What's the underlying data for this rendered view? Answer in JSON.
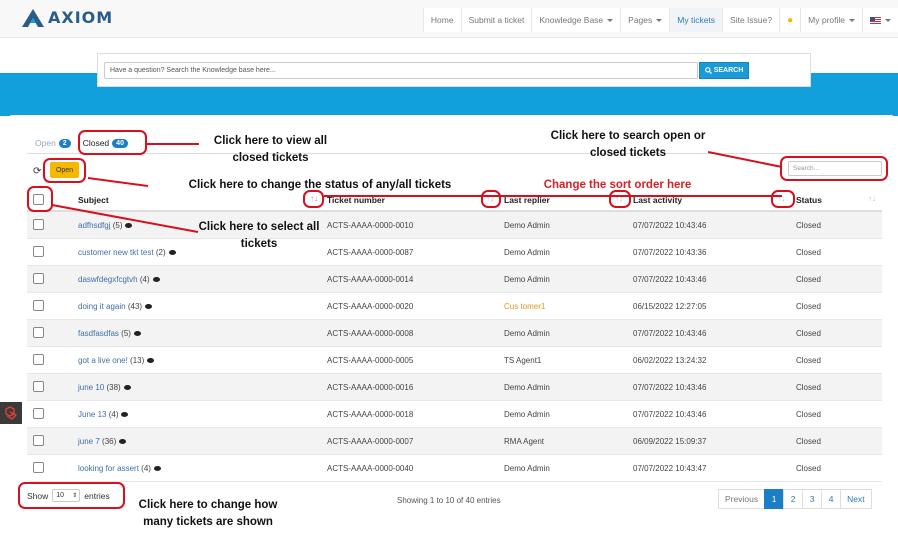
{
  "header": {
    "logo_text": "AXIOM",
    "nav": [
      {
        "label": "Home",
        "caret": false,
        "active": false
      },
      {
        "label": "Submit a ticket",
        "caret": false,
        "active": false
      },
      {
        "label": "Knowledge Base",
        "caret": true,
        "active": false
      },
      {
        "label": "Pages",
        "caret": true,
        "active": false
      },
      {
        "label": "My tickets",
        "caret": false,
        "active": true
      },
      {
        "label": "Site Issue?",
        "caret": false,
        "active": false
      },
      {
        "label": "",
        "icon": "lightbulb-icon",
        "caret": false,
        "active": false
      },
      {
        "label": "My profile",
        "caret": true,
        "active": false
      },
      {
        "label": "",
        "icon": "flag-us-icon",
        "caret": true,
        "active": false
      }
    ]
  },
  "search": {
    "placeholder": "Have a question? Search the Knowledge base here...",
    "button_label": "SEARCH"
  },
  "tabs": [
    {
      "label": "Open",
      "count": "2",
      "active": false
    },
    {
      "label": "Closed",
      "count": "40",
      "active": true
    }
  ],
  "toolbar": {
    "open_button": "Open",
    "table_search_placeholder": "Search..."
  },
  "table": {
    "headers": [
      "Subject",
      "Ticket number",
      "Last replier",
      "Last activity",
      "Status"
    ],
    "rows": [
      {
        "subject": "adfhsdfgj",
        "count": "(5)",
        "ticket": "ACTS-AAAA-0000-0010",
        "replier": "Demo Admin",
        "replier_color": "normal",
        "activity": "07/07/2022 10:43:46",
        "status": "Closed"
      },
      {
        "subject": "customer new tkt test",
        "count": "(2)",
        "ticket": "ACTS-AAAA-0000-0087",
        "replier": "Demo Admin",
        "replier_color": "normal",
        "activity": "07/07/2022 10:43:36",
        "status": "Closed"
      },
      {
        "subject": "daswfdegxfcgtvh",
        "count": "(4)",
        "ticket": "ACTS-AAAA-0000-0014",
        "replier": "Demo Admin",
        "replier_color": "normal",
        "activity": "07/07/2022 10:43:46",
        "status": "Closed"
      },
      {
        "subject": "doing it again",
        "count": "(43)",
        "ticket": "ACTS-AAAA-0000-0020",
        "replier": "Cus tomer1",
        "replier_color": "orange",
        "activity": "06/15/2022 12:27:05",
        "status": "Closed"
      },
      {
        "subject": "fasdfasdfas",
        "count": "(5)",
        "ticket": "ACTS-AAAA-0000-0008",
        "replier": "Demo Admin",
        "replier_color": "normal",
        "activity": "07/07/2022 10:43:46",
        "status": "Closed"
      },
      {
        "subject": "got a live one!",
        "count": "(13)",
        "ticket": "ACTS-AAAA-0000-0005",
        "replier": "TS Agent1",
        "replier_color": "normal",
        "activity": "06/02/2022 13:24:32",
        "status": "Closed"
      },
      {
        "subject": "june 10",
        "count": "(38)",
        "ticket": "ACTS-AAAA-0000-0016",
        "replier": "Demo Admin",
        "replier_color": "normal",
        "activity": "07/07/2022 10:43:46",
        "status": "Closed"
      },
      {
        "subject": "June 13",
        "count": "(4)",
        "ticket": "ACTS-AAAA-0000-0018",
        "replier": "Demo Admin",
        "replier_color": "normal",
        "activity": "07/07/2022 10:43:46",
        "status": "Closed"
      },
      {
        "subject": "june 7",
        "count": "(36)",
        "ticket": "ACTS-AAAA-0000-0007",
        "replier": "RMA Agent",
        "replier_color": "normal",
        "activity": "06/09/2022 15:09:37",
        "status": "Closed"
      },
      {
        "subject": "looking for assert",
        "count": "(4)",
        "ticket": "ACTS-AAAA-0000-0040",
        "replier": "Demo Admin",
        "replier_color": "normal",
        "activity": "07/07/2022 10:43:47",
        "status": "Closed"
      }
    ]
  },
  "footer": {
    "show_label": "Show",
    "entries_value": "10",
    "entries_label": "entries",
    "showing_text": "Showing 1 to 10 of 40 entries",
    "pager": [
      "Previous",
      "1",
      "2",
      "3",
      "4",
      "Next"
    ],
    "active_page": "1"
  },
  "annotations": {
    "view_closed": "Click here to view all closed tickets",
    "search": "Click here to search open or closed tickets",
    "change_status": "Click here to change the status of any/all tickets",
    "sort_order": "Change the sort order here",
    "select_all": "Click here to select all tickets",
    "change_count": "Click here to change how many tickets are shown"
  },
  "colors": {
    "brand_blue": "#12a0dc",
    "accent_blue": "#1a7fc4",
    "open_button": "#f5b800",
    "annotation_red": "#d6101e"
  }
}
